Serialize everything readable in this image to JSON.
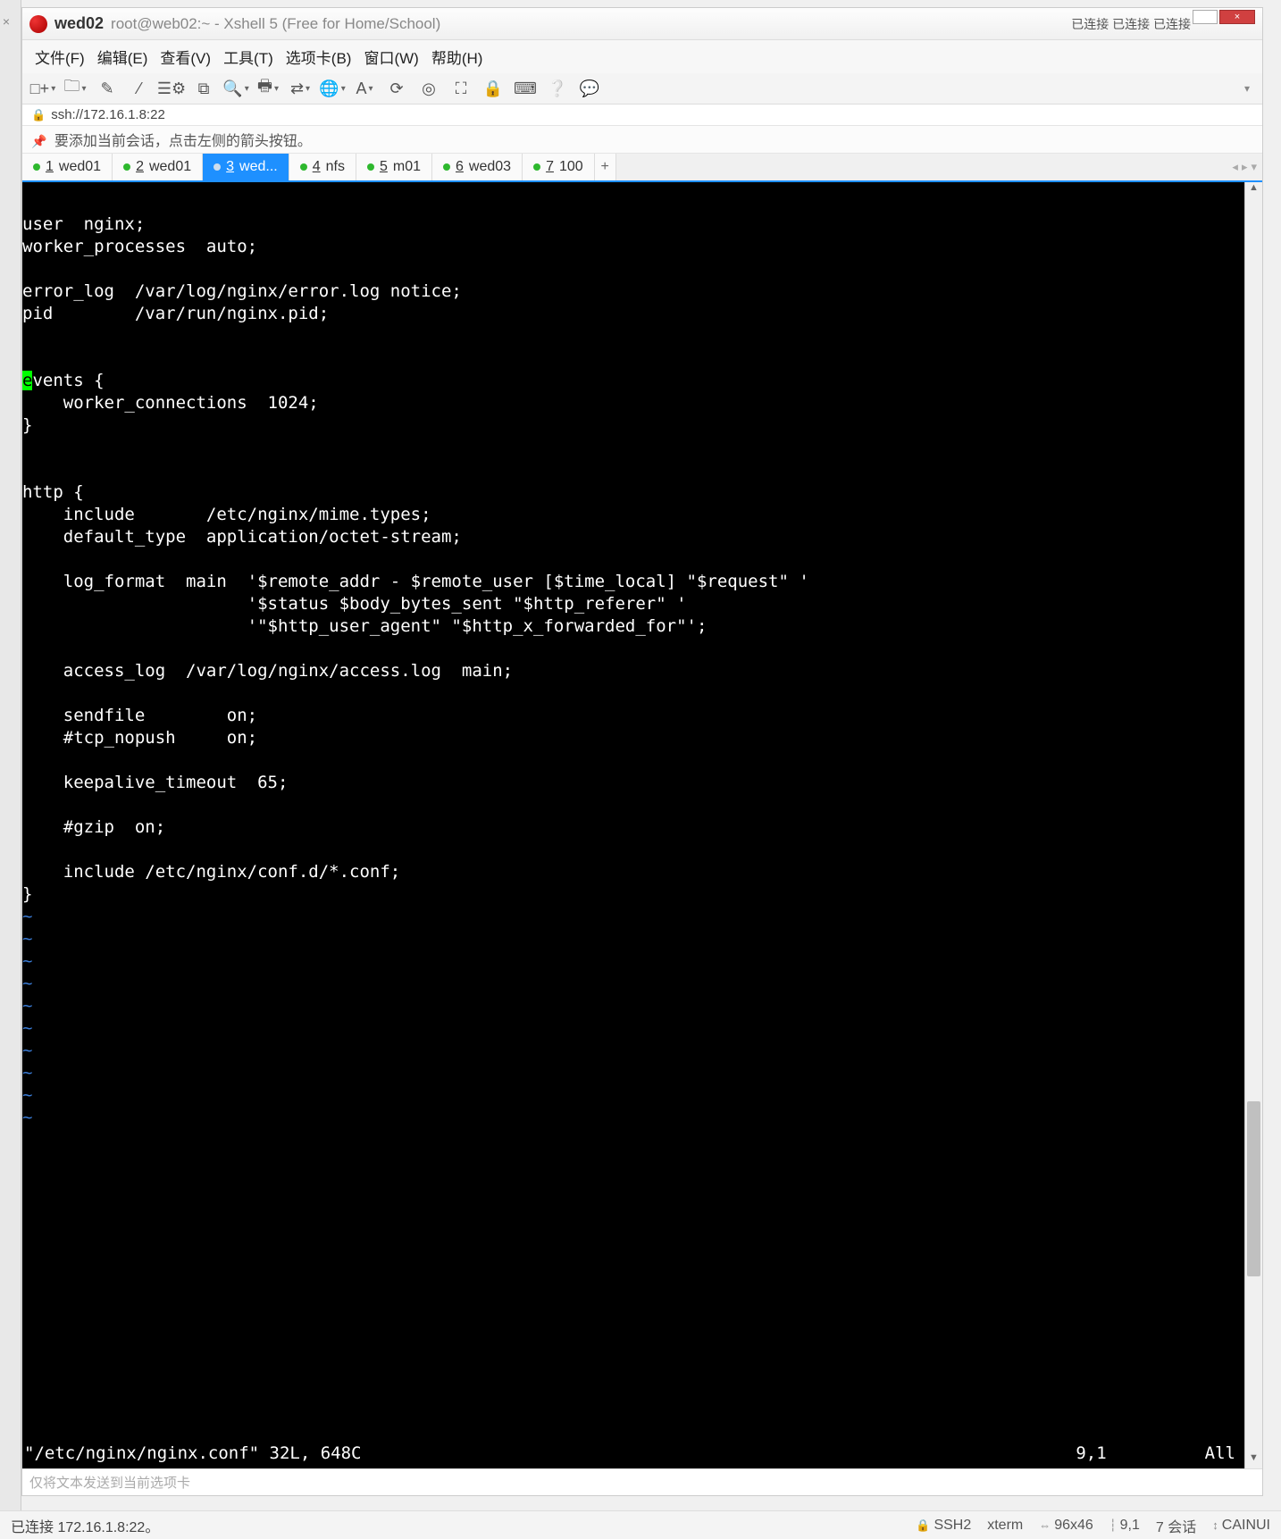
{
  "title_tab_bold": "wed02",
  "title_path": "root@web02:~ - Xshell 5 (Free for Home/School)",
  "top_right_status": "已连接 已连接 已连接",
  "menus": [
    "文件(F)",
    "编辑(E)",
    "查看(V)",
    "工具(T)",
    "选项卡(B)",
    "窗口(W)",
    "帮助(H)"
  ],
  "address": "ssh://172.16.1.8:22",
  "hint": "要添加当前会话，点击左侧的箭头按钮。",
  "tabs": [
    {
      "num": "1",
      "label": "wed01",
      "active": false
    },
    {
      "num": "2",
      "label": "wed01",
      "active": false
    },
    {
      "num": "3",
      "label": "wed...",
      "active": true
    },
    {
      "num": "4",
      "label": "nfs",
      "active": false
    },
    {
      "num": "5",
      "label": "m01",
      "active": false
    },
    {
      "num": "6",
      "label": "wed03",
      "active": false
    },
    {
      "num": "7",
      "label": "100",
      "active": false
    }
  ],
  "terminal": {
    "pre_cursor_lines": [
      "",
      "user  nginx;",
      "worker_processes  auto;",
      "",
      "error_log  /var/log/nginx/error.log notice;",
      "pid        /var/run/nginx.pid;",
      "",
      ""
    ],
    "cursor_char": "e",
    "cursor_rest": "vents {",
    "post_cursor_lines": [
      "    worker_connections  1024;",
      "}",
      "",
      "",
      "http {",
      "    include       /etc/nginx/mime.types;",
      "    default_type  application/octet-stream;",
      "",
      "    log_format  main  '$remote_addr - $remote_user [$time_local] \"$request\" '",
      "                      '$status $body_bytes_sent \"$http_referer\" '",
      "                      '\"$http_user_agent\" \"$http_x_forwarded_for\"';",
      "",
      "    access_log  /var/log/nginx/access.log  main;",
      "",
      "    sendfile        on;",
      "    #tcp_nopush     on;",
      "",
      "    keepalive_timeout  65;",
      "",
      "    #gzip  on;",
      "",
      "    include /etc/nginx/conf.d/*.conf;",
      "}"
    ],
    "tilde_count": 10,
    "status_file": "\"/etc/nginx/nginx.conf\" 32L, 648C",
    "status_pos": "9,1",
    "status_all": "All"
  },
  "send_hint": "仅将文本发送到当前选项卡",
  "statusbar": {
    "left": "已连接 172.16.1.8:22。",
    "ssh": "SSH2",
    "term": "xterm",
    "size": "96x46",
    "pos": "9,1",
    "sessions": "7 会话",
    "caps": "CAINUI"
  },
  "toolbar_icons": [
    {
      "name": "new-session-icon",
      "glyph": "□+",
      "dd": true
    },
    {
      "name": "open-icon",
      "glyph": "🗀",
      "dd": true
    },
    {
      "name": "edit-icon",
      "glyph": "✎",
      "dd": false
    },
    {
      "name": "highlight-icon",
      "glyph": "⁄",
      "dd": false
    },
    {
      "name": "properties-icon",
      "glyph": "☰⚙",
      "dd": false
    },
    {
      "name": "copy-icon",
      "glyph": "⧉",
      "dd": false
    },
    {
      "name": "search-icon",
      "glyph": "🔍",
      "dd": true
    },
    {
      "name": "print-icon",
      "glyph": "🖶",
      "dd": true
    },
    {
      "name": "transfer-icon",
      "glyph": "⇄",
      "dd": true
    },
    {
      "name": "globe-icon",
      "glyph": "🌐",
      "dd": true
    },
    {
      "name": "font-icon",
      "glyph": "A",
      "dd": true
    },
    {
      "name": "refresh-icon",
      "glyph": "⟳",
      "dd": false
    },
    {
      "name": "target-icon",
      "glyph": "◎",
      "dd": false
    },
    {
      "name": "fullscreen-icon",
      "glyph": "⛶",
      "dd": false
    },
    {
      "name": "lock-icon",
      "glyph": "🔒",
      "dd": false
    },
    {
      "name": "keyboard-icon",
      "glyph": "⌨",
      "dd": false
    },
    {
      "name": "help-icon",
      "glyph": "❔",
      "dd": false
    },
    {
      "name": "chat-icon",
      "glyph": "💬",
      "dd": false
    }
  ]
}
